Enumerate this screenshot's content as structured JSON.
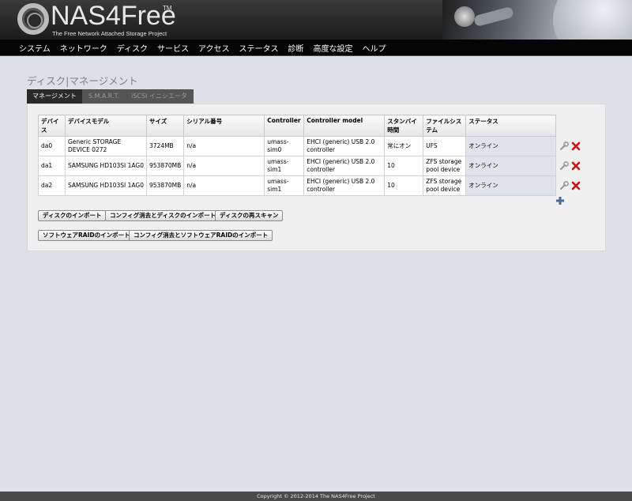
{
  "header": {
    "logo_text": "NAS4Free",
    "logo_tm": "TM",
    "subtitle": "The Free Network Attached Storage Project"
  },
  "nav": {
    "items": [
      "システム",
      "ネットワーク",
      "ディスク",
      "サービス",
      "アクセス",
      "ステータス",
      "診断",
      "高度な設定",
      "ヘルプ"
    ]
  },
  "page": {
    "title": "ディスク|マネージメント"
  },
  "tabs": [
    {
      "label": "マネージメント",
      "active": true
    },
    {
      "label": "S.M.A.R.T.",
      "active": false
    },
    {
      "label": "iSCSI イニシエータ",
      "active": false
    }
  ],
  "table": {
    "columns": [
      "デバイス",
      "デバイスモデル",
      "サイズ",
      "シリアル番号",
      "Controller",
      "Controller model",
      "スタンバイ時間",
      "ファイルシステム",
      "ステータス"
    ],
    "rows": [
      [
        "da0",
        "Generic STORAGE DEVICE 0272",
        "3724MB",
        "n/a",
        "umass-sim0",
        "EHCI (generic) USB 2.0 controller",
        "常にオン",
        "UFS",
        "オンライン"
      ],
      [
        "da1",
        "SAMSUNG HD103SI 1AG0",
        "953870MB",
        "n/a",
        "umass-sim1",
        "EHCI (generic) USB 2.0 controller",
        "10",
        "ZFS storage pool device",
        "オンライン"
      ],
      [
        "da2",
        "SAMSUNG HD103SI 1AG0",
        "953870MB",
        "n/a",
        "umass-sim1",
        "EHCI (generic) USB 2.0 controller",
        "10",
        "ZFS storage pool device",
        "オンライン"
      ]
    ]
  },
  "buttons": {
    "import_disks": "ディスクのインポート",
    "clear_import_disks": "コンフィグ消去とディスクのインポート",
    "rescan_disks": "ディスクの再スキャン",
    "import_sw_raid": "ソフトウェアRAIDのインポート",
    "clear_import_sw_raid": "コンフィグ消去とソフトウェアRAIDのインポート"
  },
  "footer": {
    "copyright": "Copyright © 2012-2014 The NAS4Free Project"
  },
  "icons": {
    "edit": "wrench-icon",
    "delete": "delete-icon",
    "add": "add-icon"
  },
  "colors": {
    "nav_bg": "#050505",
    "status_cell": "#e0e3ec",
    "delete_red": "#d01010",
    "add_blue": "#4a6a8f"
  }
}
